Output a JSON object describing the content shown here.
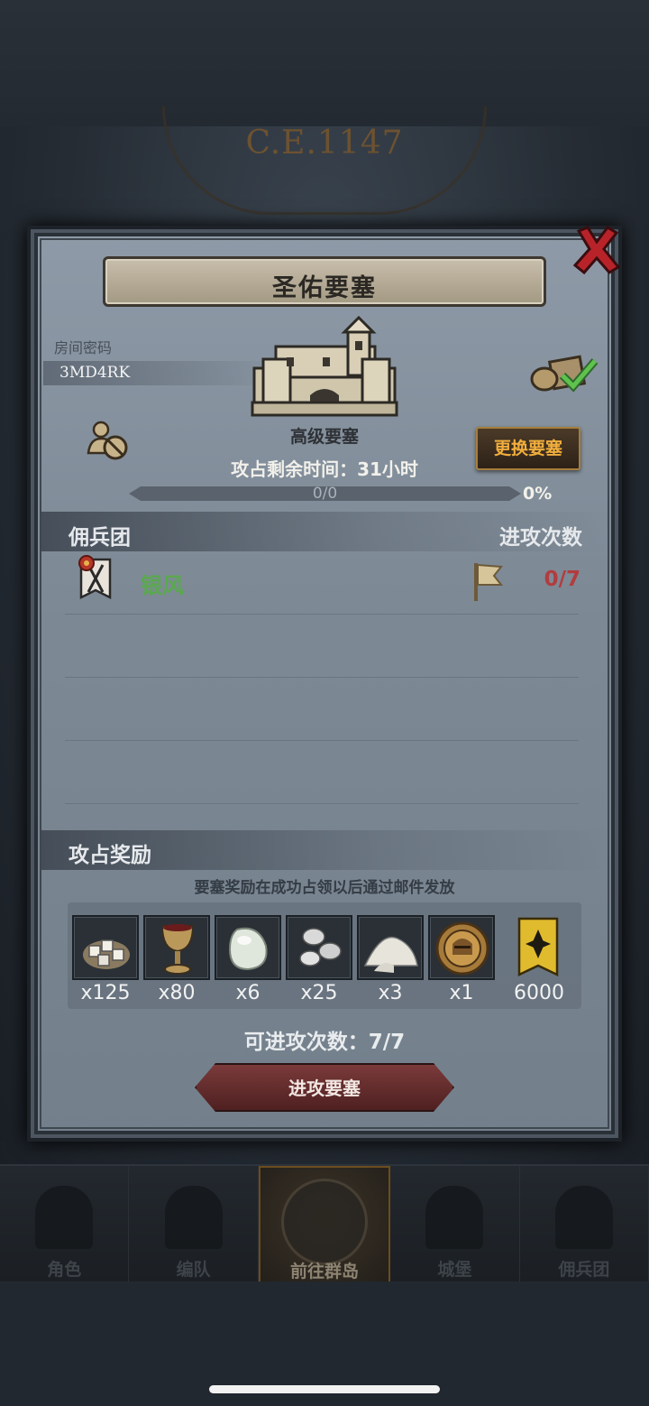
{
  "backdrop": {
    "era_label": "C.E.1147"
  },
  "dialog": {
    "title": "圣佑要塞",
    "room": {
      "label": "房间密码",
      "code": "3MD4RK"
    },
    "fortress_level": "高级要塞",
    "timer_label": "攻占剩余时间：",
    "timer_value": "31小时",
    "change_button": "更换要塞",
    "progress": {
      "text": "0/0",
      "percent_label": "0%",
      "fraction": 0
    },
    "mercenary_header": "佣兵团",
    "attack_count_header": "进攻次数",
    "mercenaries": [
      {
        "name": "银风",
        "attacks": "0/7"
      }
    ],
    "rewards_header": "攻占奖励",
    "rewards_note": "要塞奖励在成功占领以后通过邮件发放",
    "rewards": [
      {
        "icon": "sugar-cubes-icon",
        "qty": "x125"
      },
      {
        "icon": "goblet-icon",
        "qty": "x80"
      },
      {
        "icon": "moonstone-icon",
        "qty": "x6"
      },
      {
        "icon": "silver-ore-icon",
        "qty": "x25"
      },
      {
        "icon": "salt-pile-icon",
        "qty": "x3"
      },
      {
        "icon": "knight-helmet-medal-icon",
        "qty": "x1"
      },
      {
        "icon": "honor-banner-icon",
        "qty": "6000"
      }
    ],
    "remaining_attacks_label": "可进攻次数：",
    "remaining_attacks_value": "7/7",
    "attack_button": "进攻要塞"
  },
  "nav": [
    {
      "label": "角色",
      "icon": "knight-icon",
      "active": false
    },
    {
      "label": "编队",
      "icon": "formation-helmet-icon",
      "active": false
    },
    {
      "label": "前往群岛",
      "icon": "compass-icon",
      "active": true
    },
    {
      "label": "城堡",
      "icon": "castle-icon",
      "active": false
    },
    {
      "label": "佣兵团",
      "icon": "mercenary-banner-icon",
      "active": false
    }
  ],
  "colors": {
    "merc_name": "#5aa84f",
    "attack_count": "#b23c3e",
    "change_button_text": "#f1ae3d",
    "attack_button": "#6a2d2d"
  }
}
